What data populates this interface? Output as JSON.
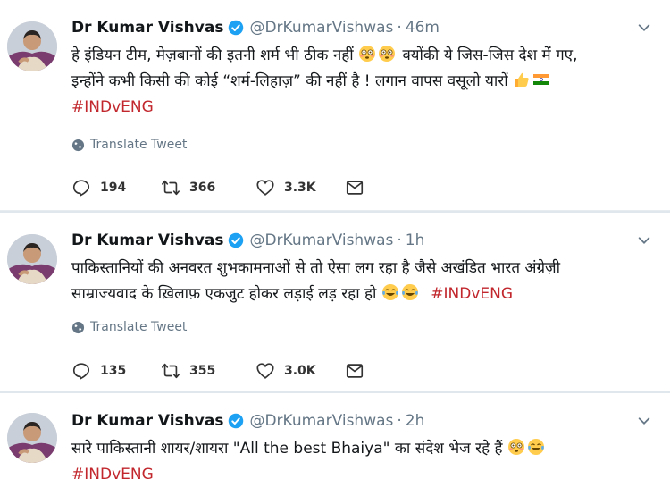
{
  "tweets": [
    {
      "name": "Dr Kumar Vishvas",
      "handle": "@DrKumarVishwas",
      "separator": "·",
      "time": "46m",
      "lines": [
        "हे इंडियन टीम, मेज़बानों की इतनी शर्म भी ठीक नहीं",
        "क्योंकी ये जिस-जिस देश में गए,",
        "इन्होंने कभी किसी की कोई “शर्म-लिहाज़” की नहीं है ! लगान वापस वसूलो यारों",
        "#INDvENG"
      ],
      "translate_label": "Translate Tweet",
      "replies": "194",
      "retweets": "366",
      "likes": "3.3K"
    },
    {
      "name": "Dr Kumar Vishvas",
      "handle": "@DrKumarVishwas",
      "separator": "·",
      "time": "1h",
      "lines": [
        "पाकिस्तानियों की अनवरत शुभकामनाओं से तो ऐसा लग रहा है जैसे अखंडित भारत अंग्रेज़ी",
        "साम्राज्यवाद के ख़िलाफ़ एकजुट होकर लड़ाई लड़ रहा हो",
        "#INDvENG"
      ],
      "translate_label": "Translate Tweet",
      "replies": "135",
      "retweets": "355",
      "likes": "3.0K"
    },
    {
      "name": "Dr Kumar Vishvas",
      "handle": "@DrKumarVishwas",
      "separator": "·",
      "time": "2h",
      "lines": [
        "सारे पाकिस्तानी शायर/शायरा \"All the best Bhaiya\" का संदेश भेज रहे हैं",
        "#INDvENG"
      ]
    }
  ],
  "colors": {
    "hashtag": "#c1272d",
    "verified": "#1da1f2",
    "muted": "#657786"
  },
  "icons": {
    "reply": "reply-icon",
    "retweet": "retweet-icon",
    "like": "heart-icon",
    "dm": "envelope-icon",
    "translate": "globe-icon",
    "caret": "chevron-down-icon",
    "verified": "verified-badge-icon"
  }
}
